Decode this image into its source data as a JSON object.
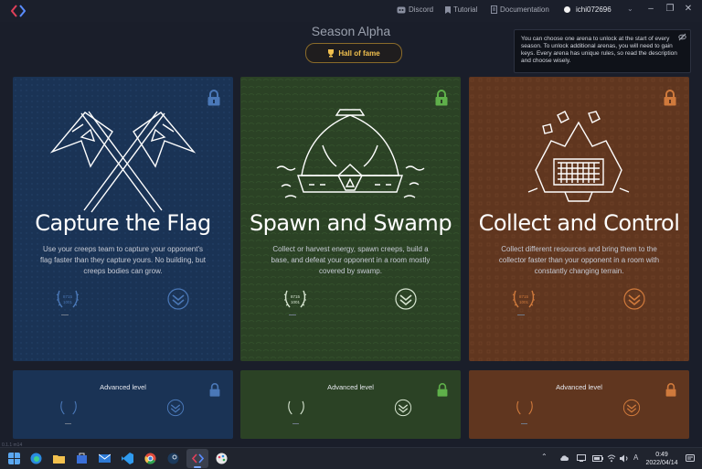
{
  "topbar": {
    "links": [
      {
        "label": "Discord",
        "icon": "discord-icon"
      },
      {
        "label": "Tutorial",
        "icon": "bookmark-icon"
      },
      {
        "label": "Documentation",
        "icon": "document-icon"
      }
    ],
    "username": "ichi072696"
  },
  "header": {
    "title": "Season Alpha",
    "hall_of_fame": "Hall of fame"
  },
  "tooltip": {
    "text": "You can choose one arena to unlock at the start of every season. To unlock additional arenas, you will need to gain keys. Every arena has unique rules, so read the description and choose wisely."
  },
  "arenas": [
    {
      "title": "Capture the Flag",
      "description": "Use your creeps team to capture your opponent's flag faster than they capture yours. No building, but creeps bodies can grow.",
      "color": "#1a3355",
      "accent": "#4a78b8",
      "badge_text": "8715 1001",
      "rank_dash": "—"
    },
    {
      "title": "Spawn and Swamp",
      "description": "Collect or harvest energy, spawn creeps, build a base, and defeat your opponent in a room mostly covered by swamp.",
      "color": "#2b4225",
      "accent": "#5fb04a",
      "badge_text": "8715 1001",
      "rank_dash": "—"
    },
    {
      "title": "Collect and Control",
      "description": "Collect different resources and bring them to the collector faster than your opponent in a room with constantly changing terrain.",
      "color": "#60361f",
      "accent": "#d07a3c",
      "badge_text": "8715 1001",
      "rank_dash": "—"
    }
  ],
  "advanced": {
    "label": "Advanced level"
  },
  "version": "0.1.1 m14",
  "taskbar": {
    "time": "0:49",
    "date": "2022/04/14",
    "lang": "A"
  }
}
